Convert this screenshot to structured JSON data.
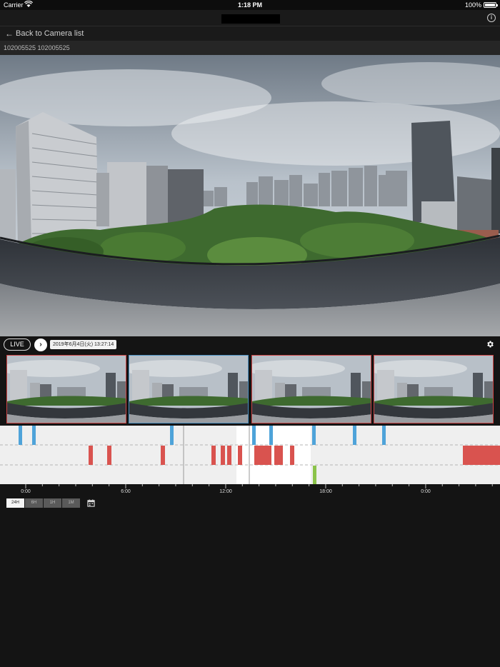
{
  "status_bar": {
    "carrier": "Carrier",
    "time": "1:18 PM",
    "battery": "100%"
  },
  "nav": {
    "back_label": "Back to Camera list",
    "info_icon": "info-icon"
  },
  "camera": {
    "id_label": "102005525 102005525"
  },
  "controls": {
    "live_label": "LIVE",
    "datetime": "2019年6月4日(火) 13:27:14"
  },
  "timeline": {
    "tick_labels": [
      "0:00",
      "6:00",
      "12:00",
      "18:00",
      "0:00"
    ],
    "colors": {
      "motion": "#4ea3d9",
      "alert": "#d9534f",
      "event": "#8bc34a",
      "background": "#efefef",
      "highlight": "#ffffff"
    }
  },
  "ranges": {
    "items": [
      {
        "label": "24H",
        "active": true
      },
      {
        "label": "6H",
        "active": false
      },
      {
        "label": "1H",
        "active": false
      },
      {
        "label": "1M",
        "active": false
      }
    ]
  }
}
